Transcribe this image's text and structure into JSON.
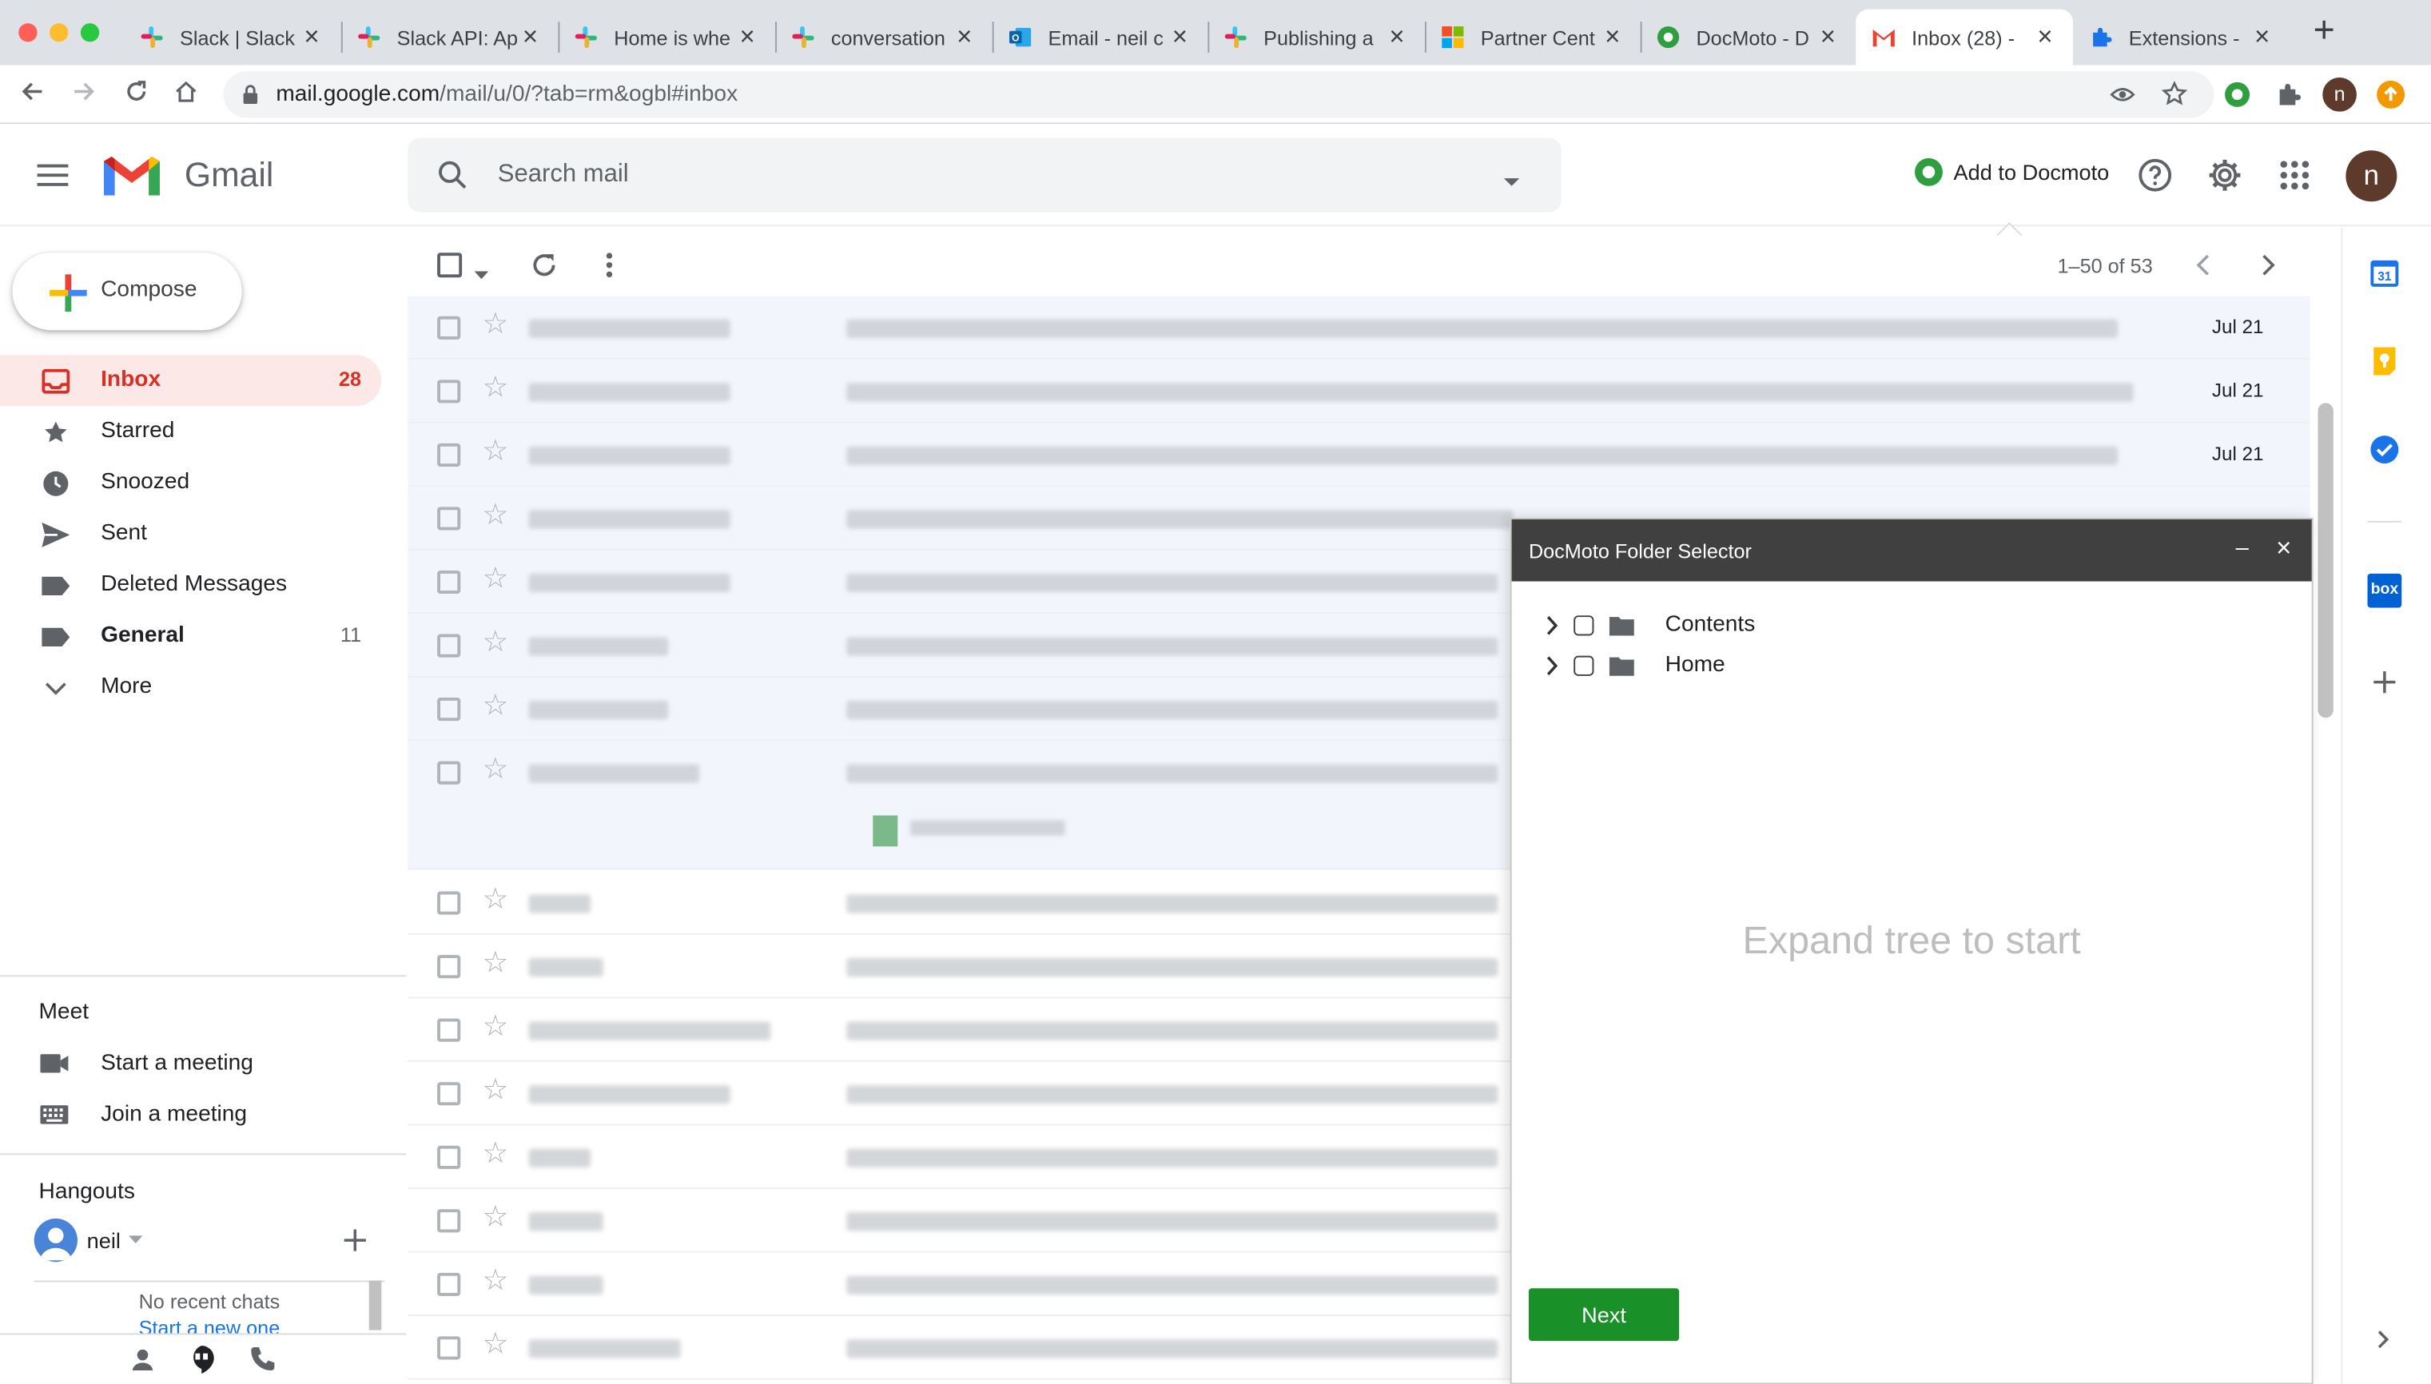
{
  "browser": {
    "tabs": [
      {
        "title": "Slack | Slack",
        "icon": "slack-icon"
      },
      {
        "title": "Slack API: Ap",
        "icon": "slack-icon"
      },
      {
        "title": "Home is whe",
        "icon": "slack-icon"
      },
      {
        "title": "conversation",
        "icon": "slack-icon"
      },
      {
        "title": "Email - neil c",
        "icon": "outlook-icon"
      },
      {
        "title": "Publishing a",
        "icon": "slack-icon"
      },
      {
        "title": "Partner Cent",
        "icon": "microsoft-icon"
      },
      {
        "title": "DocMoto - D",
        "icon": "docmoto-icon"
      },
      {
        "title": "Inbox (28) -",
        "icon": "gmail-icon"
      },
      {
        "title": "Extensions -",
        "icon": "puzzle-icon"
      }
    ],
    "url_host": "mail.google.com",
    "url_path": "/mail/u/0/?tab=rm&ogbl#inbox",
    "profile_initial": "n"
  },
  "gmail": {
    "product_name": "Gmail",
    "search_placeholder": "Search mail",
    "add_to_docmoto": "Add to Docmoto",
    "account_initial": "n",
    "compose_label": "Compose",
    "nav": [
      {
        "label": "Inbox",
        "count": "28",
        "icon": "inbox-icon"
      },
      {
        "label": "Starred",
        "count": "",
        "icon": "star-icon"
      },
      {
        "label": "Snoozed",
        "count": "",
        "icon": "clock-icon"
      },
      {
        "label": "Sent",
        "count": "",
        "icon": "send-icon"
      },
      {
        "label": "Deleted Messages",
        "count": "",
        "icon": "label-icon"
      },
      {
        "label": "General",
        "count": "11",
        "icon": "label-icon"
      },
      {
        "label": "More",
        "count": "",
        "icon": "chevron-down-icon"
      }
    ],
    "meet": {
      "title": "Meet",
      "start": "Start a meeting",
      "join": "Join a meeting"
    },
    "hangouts": {
      "title": "Hangouts",
      "user": "neil",
      "no_recent": "No recent chats",
      "start_new": "Start a new one"
    },
    "pager": "1–50 of 53",
    "dates": [
      "Jul 21",
      "Jul 21",
      "Jul 21"
    ]
  },
  "docmoto_dialog": {
    "title": "DocMoto Folder Selector",
    "folders": [
      "Contents",
      "Home"
    ],
    "hint": "Expand tree to start",
    "next_label": "Next"
  },
  "colors": {
    "gmail_red": "#d93025",
    "inbox_selected_bg": "#fce8e6",
    "dialog_header": "#404040",
    "next_button": "#1a9128"
  }
}
